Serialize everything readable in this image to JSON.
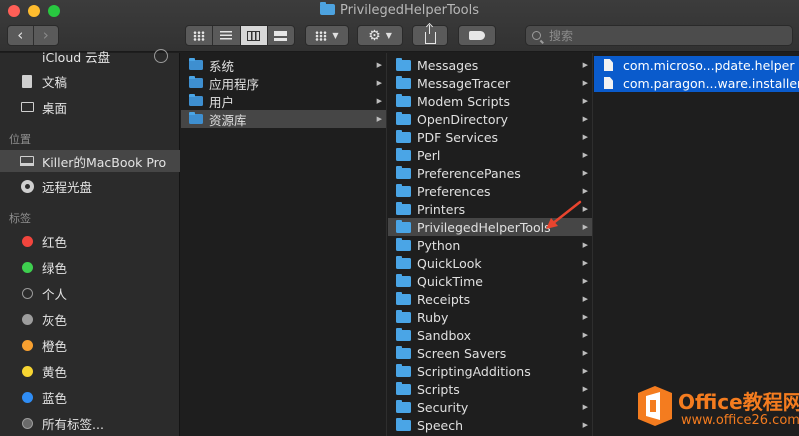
{
  "window": {
    "title": "PrivilegedHelperTools"
  },
  "toolbar": {
    "back_icon": "chevron-left-icon",
    "forward_icon": "chevron-right-icon",
    "view_modes": [
      "icon-view",
      "list-view",
      "column-view",
      "gallery-view"
    ],
    "active_view": "column-view",
    "search_placeholder": "搜索"
  },
  "sidebar": {
    "top_items": [
      {
        "label": "iCloud 云盘",
        "icon": "cloud-icon"
      },
      {
        "label": "文稿",
        "icon": "document-icon"
      },
      {
        "label": "桌面",
        "icon": "desktop-icon"
      }
    ],
    "locations_header": "位置",
    "locations": [
      {
        "label": "Killer的MacBook Pro",
        "icon": "laptop-icon",
        "selected": true
      },
      {
        "label": "远程光盘",
        "icon": "disc-icon"
      }
    ],
    "tags_header": "标签",
    "tags": [
      {
        "label": "红色",
        "color": "#f2453d"
      },
      {
        "label": "绿色",
        "color": "#3ecf4f"
      },
      {
        "label": "个人",
        "color": ""
      },
      {
        "label": "灰色",
        "color": "#9d9d9d"
      },
      {
        "label": "橙色",
        "color": "#f8a030"
      },
      {
        "label": "黄色",
        "color": "#f7d532"
      },
      {
        "label": "蓝色",
        "color": "#2f8df5"
      },
      {
        "label": "所有标签...",
        "color": "#9d9d9d"
      }
    ]
  },
  "columns": {
    "col1": [
      {
        "label": "系统"
      },
      {
        "label": "应用程序"
      },
      {
        "label": "用户"
      },
      {
        "label": "资源库",
        "selected": true
      }
    ],
    "col2": [
      {
        "label": "Messages"
      },
      {
        "label": "MessageTracer"
      },
      {
        "label": "Modem Scripts"
      },
      {
        "label": "OpenDirectory"
      },
      {
        "label": "PDF Services"
      },
      {
        "label": "Perl"
      },
      {
        "label": "PreferencePanes"
      },
      {
        "label": "Preferences"
      },
      {
        "label": "Printers"
      },
      {
        "label": "PrivilegedHelperTools",
        "selected": true
      },
      {
        "label": "Python"
      },
      {
        "label": "QuickLook"
      },
      {
        "label": "QuickTime"
      },
      {
        "label": "Receipts"
      },
      {
        "label": "Ruby"
      },
      {
        "label": "Sandbox"
      },
      {
        "label": "Screen Savers"
      },
      {
        "label": "ScriptingAdditions"
      },
      {
        "label": "Scripts"
      },
      {
        "label": "Security"
      },
      {
        "label": "Speech"
      }
    ],
    "col3": [
      {
        "label": "com.microso...pdate.helper"
      },
      {
        "label": "com.paragon...ware.installer"
      }
    ]
  },
  "colors": {
    "selection_blue": "#0a5bcc",
    "folder_blue": "#4aa5e6",
    "annotation_red": "#e8442e",
    "watermark_orange": "#f47c1f"
  },
  "watermark": {
    "name": "Office教程网",
    "url": "www.office26.com"
  }
}
